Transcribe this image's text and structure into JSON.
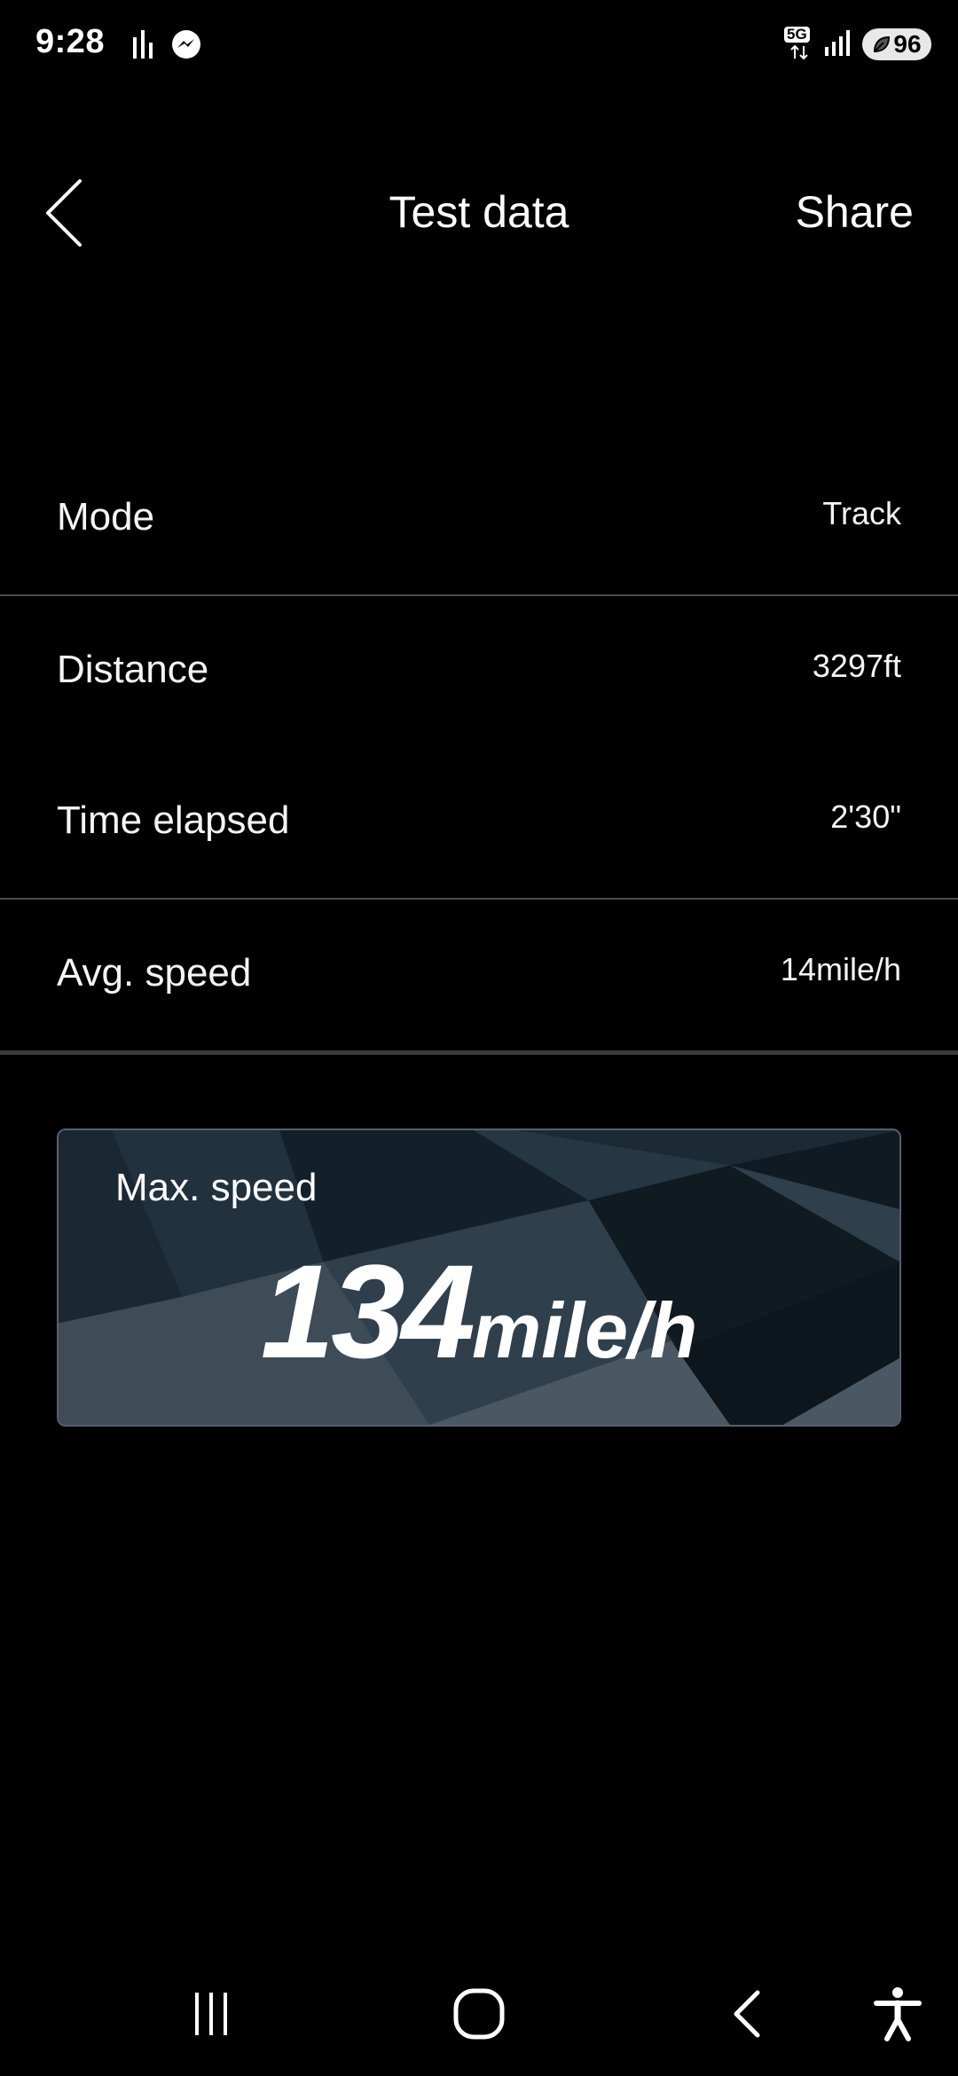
{
  "status_bar": {
    "time": "9:28",
    "network": "5G",
    "battery": "96"
  },
  "header": {
    "title": "Test data",
    "share_label": "Share"
  },
  "rows": [
    {
      "label": "Mode",
      "value": "Track"
    },
    {
      "label": "Distance",
      "value": "3297ft"
    },
    {
      "label": "Time elapsed",
      "value": "2'30\""
    },
    {
      "label": "Avg. speed",
      "value": "14mile/h"
    }
  ],
  "max_speed": {
    "label": "Max. speed",
    "value": "134",
    "unit": "mile/h"
  },
  "icons": {
    "back": "back-chevron-icon",
    "status_left": [
      "bars-icon",
      "messenger-icon"
    ],
    "status_right": [
      "5g-icon",
      "signal-icon",
      "battery-icon"
    ],
    "nav": [
      "recent-apps-icon",
      "home-icon",
      "back-icon",
      "accessibility-icon"
    ]
  },
  "colors": {
    "background": "#000000",
    "text": "#ffffff",
    "divider": "#4a4a4a",
    "card": "#1c2c37"
  }
}
